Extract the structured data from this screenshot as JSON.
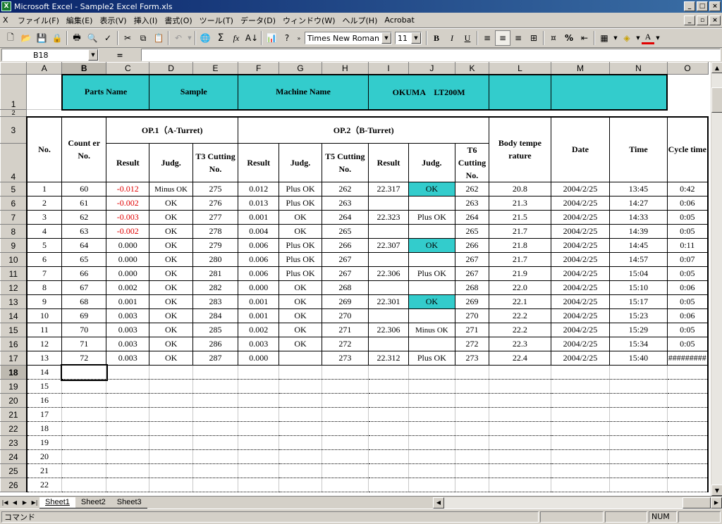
{
  "window": {
    "title": "Microsoft Excel - Sample2 Excel Form.xls"
  },
  "menu": [
    "ファイル(F)",
    "編集(E)",
    "表示(V)",
    "挿入(I)",
    "書式(O)",
    "ツール(T)",
    "データ(D)",
    "ウィンドウ(W)",
    "ヘルプ(H)",
    "Acrobat"
  ],
  "toolbar": {
    "font": "Times New Roman",
    "size": "11"
  },
  "formula": {
    "cell_ref": "B18",
    "equals": "=",
    "value": ""
  },
  "columns": [
    "A",
    "B",
    "C",
    "D",
    "E",
    "F",
    "G",
    "H",
    "I",
    "J",
    "K",
    "L",
    "M",
    "N",
    "O"
  ],
  "title_row": {
    "parts_name": "Parts Name",
    "sample": "Sample",
    "machine_name": "Machine Name",
    "machine": "OKUMA　LT200M"
  },
  "headers": {
    "no": "No.",
    "counter": "Count er No.",
    "op1": "OP.1（A-Turret)",
    "op2": "OP.2（B-Turret)",
    "body_temp": "Body tempe rature",
    "date": "Date",
    "time": "Time",
    "cycle": "Cycle time",
    "result1": "Result",
    "judg1": "Judg.",
    "t3": "T3 Cutting No.",
    "result2": "Result",
    "judg2": "Judg.",
    "t5": "T5 Cutting No.",
    "result3": "Result",
    "judg3": "Judg.",
    "t6": "T6 Cutting No."
  },
  "row_numbers": {
    "r1": "1",
    "r2": "2",
    "r3": "3",
    "r4": "4"
  },
  "rows": [
    [
      "1",
      "60",
      "-0.012",
      "Minus OK",
      "275",
      "0.012",
      "Plus OK",
      "262",
      "22.317",
      "OK",
      "262",
      "20.8",
      "2004/2/25",
      "13:45",
      "0:42"
    ],
    [
      "2",
      "61",
      "-0.002",
      "OK",
      "276",
      "0.013",
      "Plus OK",
      "263",
      "",
      "",
      "263",
      "21.3",
      "2004/2/25",
      "14:27",
      "0:06"
    ],
    [
      "3",
      "62",
      "-0.003",
      "OK",
      "277",
      "0.001",
      "OK",
      "264",
      "22.323",
      "Plus OK",
      "264",
      "21.5",
      "2004/2/25",
      "14:33",
      "0:05"
    ],
    [
      "4",
      "63",
      "-0.002",
      "OK",
      "278",
      "0.004",
      "OK",
      "265",
      "",
      "",
      "265",
      "21.7",
      "2004/2/25",
      "14:39",
      "0:05"
    ],
    [
      "5",
      "64",
      "0.000",
      "OK",
      "279",
      "0.006",
      "Plus OK",
      "266",
      "22.307",
      "OK",
      "266",
      "21.8",
      "2004/2/25",
      "14:45",
      "0:11"
    ],
    [
      "6",
      "65",
      "0.000",
      "OK",
      "280",
      "0.006",
      "Plus OK",
      "267",
      "",
      "",
      "267",
      "21.7",
      "2004/2/25",
      "14:57",
      "0:07"
    ],
    [
      "7",
      "66",
      "0.000",
      "OK",
      "281",
      "0.006",
      "Plus OK",
      "267",
      "22.306",
      "Plus OK",
      "267",
      "21.9",
      "2004/2/25",
      "15:04",
      "0:05"
    ],
    [
      "8",
      "67",
      "0.002",
      "OK",
      "282",
      "0.000",
      "OK",
      "268",
      "",
      "",
      "268",
      "22.0",
      "2004/2/25",
      "15:10",
      "0:06"
    ],
    [
      "9",
      "68",
      "0.001",
      "OK",
      "283",
      "0.001",
      "OK",
      "269",
      "22.301",
      "OK",
      "269",
      "22.1",
      "2004/2/25",
      "15:17",
      "0:05"
    ],
    [
      "10",
      "69",
      "0.003",
      "OK",
      "284",
      "0.001",
      "OK",
      "270",
      "",
      "",
      "270",
      "22.2",
      "2004/2/25",
      "15:23",
      "0:06"
    ],
    [
      "11",
      "70",
      "0.003",
      "OK",
      "285",
      "0.002",
      "OK",
      "271",
      "22.306",
      "Minus OK",
      "271",
      "22.2",
      "2004/2/25",
      "15:29",
      "0:05"
    ],
    [
      "12",
      "71",
      "0.003",
      "OK",
      "286",
      "0.003",
      "OK",
      "272",
      "",
      "",
      "272",
      "22.3",
      "2004/2/25",
      "15:34",
      "0:05"
    ],
    [
      "13",
      "72",
      "0.003",
      "OK",
      "287",
      "0.000",
      "",
      "273",
      "22.312",
      "Plus OK",
      "273",
      "22.4",
      "2004/2/25",
      "15:40",
      "#########"
    ]
  ],
  "empty_rows": [
    "14",
    "15",
    "16",
    "17",
    "18",
    "19",
    "20",
    "21",
    "22"
  ],
  "sheets": [
    "Sheet1",
    "Sheet2",
    "Sheet3"
  ],
  "status": {
    "mode": "コマンド",
    "num": "NUM"
  },
  "colors": {
    "teal": "#33cccc",
    "negative": "#e00000"
  }
}
